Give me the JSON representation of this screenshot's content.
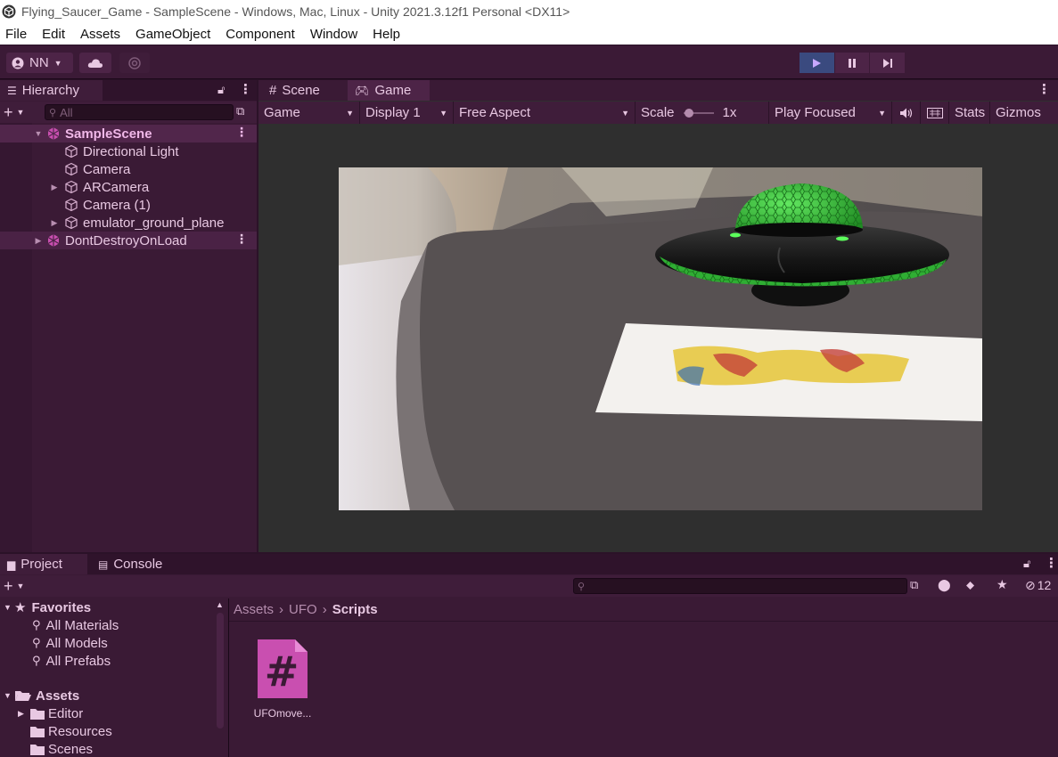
{
  "window": {
    "title": "Flying_Saucer_Game - SampleScene - Windows, Mac, Linux - Unity 2021.3.12f1 Personal <DX11>"
  },
  "menu": [
    "File",
    "Edit",
    "Assets",
    "GameObject",
    "Component",
    "Window",
    "Help"
  ],
  "toolbar": {
    "account_label": "NN"
  },
  "hierarchy": {
    "tab_label": "Hierarchy",
    "search_placeholder": "All",
    "items": [
      {
        "label": "SampleScene",
        "type": "scene"
      },
      {
        "label": "Directional Light",
        "type": "object"
      },
      {
        "label": "Camera",
        "type": "object"
      },
      {
        "label": "ARCamera",
        "type": "object"
      },
      {
        "label": "Camera (1)",
        "type": "object"
      },
      {
        "label": "emulator_ground_plane",
        "type": "object"
      },
      {
        "label": "DontDestroyOnLoad",
        "type": "scene"
      }
    ]
  },
  "game_view": {
    "tabs": [
      "Scene",
      "Game"
    ],
    "active_tab": "Game",
    "mode": "Game",
    "display": "Display 1",
    "aspect": "Free Aspect",
    "scale_label": "Scale",
    "scale_value": "1x",
    "play_mode": "Play Focused",
    "stats_label": "Stats",
    "gizmos_label": "Gizmos"
  },
  "project": {
    "tabs": [
      "Project",
      "Console"
    ],
    "hidden_count": "12",
    "favorites_label": "Favorites",
    "favorites": [
      "All Materials",
      "All Models",
      "All Prefabs"
    ],
    "assets_label": "Assets",
    "asset_folders": [
      "Editor",
      "Resources",
      "Scenes"
    ],
    "breadcrumb": [
      "Assets",
      "UFO",
      "Scripts"
    ],
    "files": [
      {
        "name": "UFOmove...",
        "type": "csharp-script"
      }
    ]
  },
  "colors": {
    "accent": "#c94fb0",
    "panel": "#3a1a35",
    "ufo_green": "#39c03c"
  }
}
